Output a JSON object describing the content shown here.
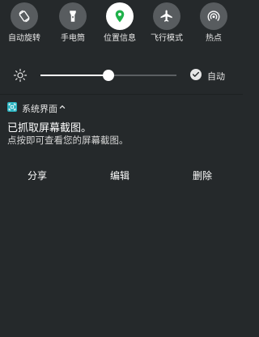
{
  "quick_settings": {
    "tiles": [
      {
        "label": "自动旋转",
        "icon": "auto-rotate-icon",
        "active": false
      },
      {
        "label": "手电筒",
        "icon": "flashlight-icon",
        "active": false
      },
      {
        "label": "位置信息",
        "icon": "location-pin-icon",
        "active": true
      },
      {
        "label": "飞行模式",
        "icon": "airplane-icon",
        "active": false
      },
      {
        "label": "热点",
        "icon": "hotspot-icon",
        "active": false
      }
    ]
  },
  "brightness": {
    "level": 0.5,
    "auto_label": "自动",
    "auto_enabled": true
  },
  "notification": {
    "app_name": "系统界面",
    "title": "已抓取屏幕截图。",
    "body": "点按即可查看您的屏幕截图。",
    "actions": {
      "share": "分享",
      "edit": "编辑",
      "delete": "删除"
    }
  },
  "colors": {
    "background": "#25292b",
    "tile_inactive": "#585c5f",
    "tile_active": "#ffffff",
    "location_green": "#1fb14a",
    "app_icon": "#2ab3c0"
  }
}
